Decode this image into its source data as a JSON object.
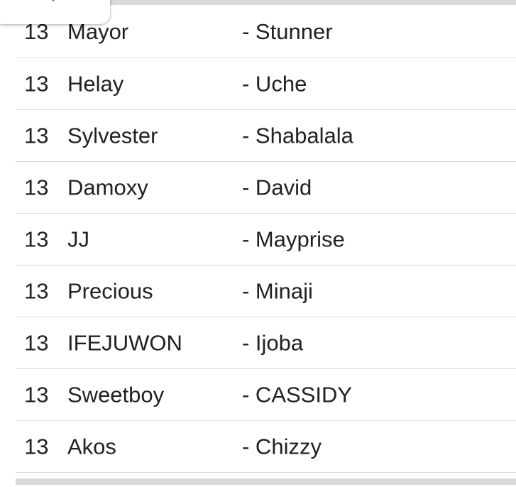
{
  "rows": [
    {
      "num": "13",
      "first": "Mayor",
      "second": "- Stunner"
    },
    {
      "num": "13",
      "first": "Helay",
      "second": "- Uche"
    },
    {
      "num": "13",
      "first": "Sylvester",
      "second": "- Shabalala"
    },
    {
      "num": "13",
      "first": "Damoxy",
      "second": "- David"
    },
    {
      "num": "13",
      "first": "JJ",
      "second": "- Mayprise"
    },
    {
      "num": "13",
      "first": "Precious",
      "second": "- Minaji"
    },
    {
      "num": "13",
      "first": "IFEJUWON",
      "second": "- Ijoba"
    },
    {
      "num": "13",
      "first": "Sweetboy",
      "second": "- CASSIDY"
    },
    {
      "num": "13",
      "first": "Akos",
      "second": "- Chizzy"
    }
  ],
  "icons": {
    "dropdown": "chevron-down-icon"
  },
  "colors": {
    "text": "#212121",
    "divider": "#dcdcdc",
    "rule": "#d9d9d9"
  }
}
